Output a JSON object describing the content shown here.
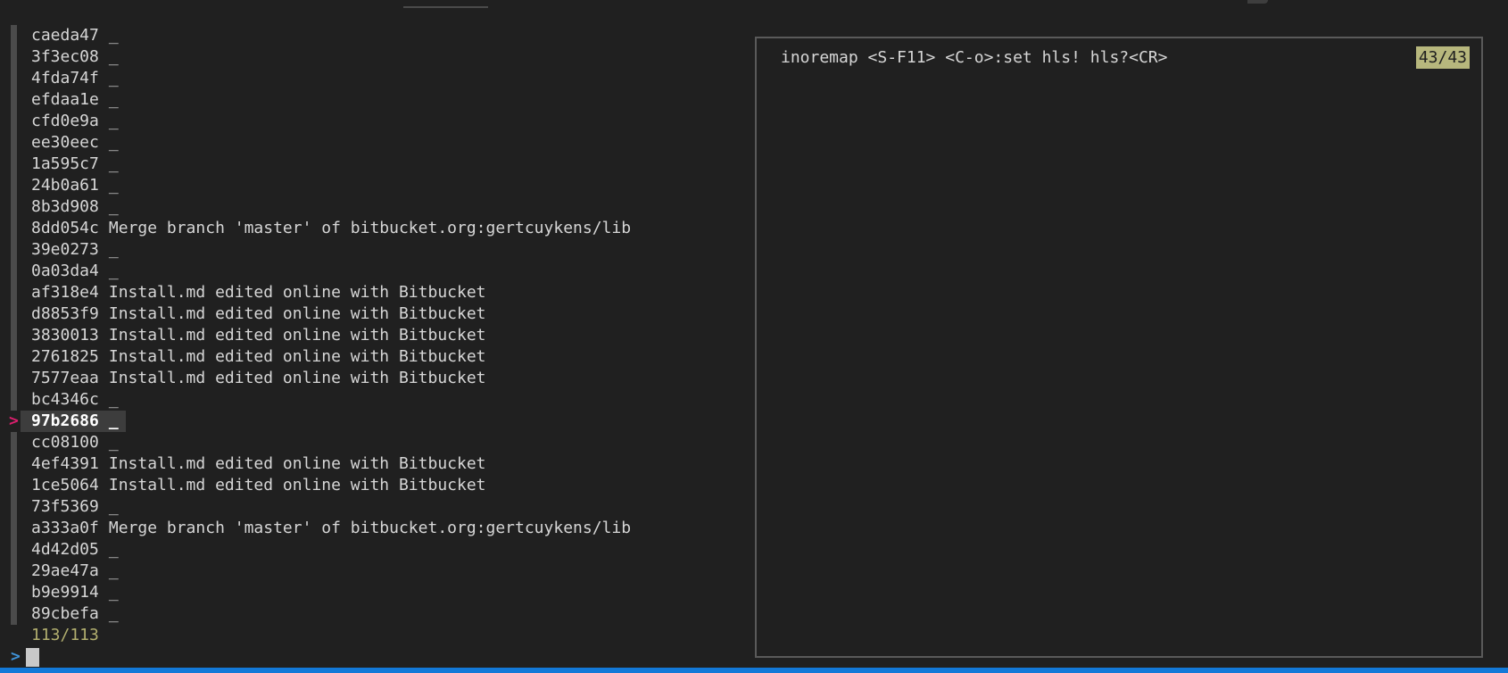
{
  "colors": {
    "background": "#202020",
    "text": "#d6d6d6",
    "gutter": "#4b4b4b",
    "pointer": "#dc1f6e",
    "selected_bg": "#3d3d3d",
    "selected_text": "#ffffff",
    "counter": "#b2af6f",
    "prompt": "#3f93d8",
    "cursor": "#c9c9c9",
    "badge_bg": "#b7b77d",
    "badge_text": "#202020",
    "preview_border": "#5a5a5a",
    "bottom_bar": "#1379d8"
  },
  "commit_list": {
    "pointer_symbol": ">",
    "prompt_symbol": ">",
    "counter": "113/113",
    "items": [
      {
        "hash": "caeda47",
        "message": "_",
        "selected": false
      },
      {
        "hash": "3f3ec08",
        "message": "_",
        "selected": false
      },
      {
        "hash": "4fda74f",
        "message": "_",
        "selected": false
      },
      {
        "hash": "efdaa1e",
        "message": "_",
        "selected": false
      },
      {
        "hash": "cfd0e9a",
        "message": "_",
        "selected": false
      },
      {
        "hash": "ee30eec",
        "message": "_",
        "selected": false
      },
      {
        "hash": "1a595c7",
        "message": "_",
        "selected": false
      },
      {
        "hash": "24b0a61",
        "message": "_",
        "selected": false
      },
      {
        "hash": "8b3d908",
        "message": "_",
        "selected": false
      },
      {
        "hash": "8dd054c",
        "message": "Merge branch 'master' of bitbucket.org:gertcuykens/lib",
        "selected": false
      },
      {
        "hash": "39e0273",
        "message": "_",
        "selected": false
      },
      {
        "hash": "0a03da4",
        "message": "_",
        "selected": false
      },
      {
        "hash": "af318e4",
        "message": "Install.md edited online with Bitbucket",
        "selected": false
      },
      {
        "hash": "d8853f9",
        "message": "Install.md edited online with Bitbucket",
        "selected": false
      },
      {
        "hash": "3830013",
        "message": "Install.md edited online with Bitbucket",
        "selected": false
      },
      {
        "hash": "2761825",
        "message": "Install.md edited online with Bitbucket",
        "selected": false
      },
      {
        "hash": "7577eaa",
        "message": "Install.md edited online with Bitbucket",
        "selected": false
      },
      {
        "hash": "bc4346c",
        "message": "_",
        "selected": false
      },
      {
        "hash": "97b2686",
        "message": "_",
        "selected": true
      },
      {
        "hash": "cc08100",
        "message": "_",
        "selected": false
      },
      {
        "hash": "4ef4391",
        "message": "Install.md edited online with Bitbucket",
        "selected": false
      },
      {
        "hash": "1ce5064",
        "message": "Install.md edited online with Bitbucket",
        "selected": false
      },
      {
        "hash": "73f5369",
        "message": "_",
        "selected": false
      },
      {
        "hash": "a333a0f",
        "message": "Merge branch 'master' of bitbucket.org:gertcuykens/lib",
        "selected": false
      },
      {
        "hash": "4d42d05",
        "message": "_",
        "selected": false
      },
      {
        "hash": "29ae47a",
        "message": "_",
        "selected": false
      },
      {
        "hash": "b9e9914",
        "message": "_",
        "selected": false
      },
      {
        "hash": "89cbefa",
        "message": "_",
        "selected": false
      }
    ]
  },
  "preview": {
    "content": "inoremap <S-F11> <C-o>:set hls! hls?<CR>",
    "counter": "43/43"
  }
}
